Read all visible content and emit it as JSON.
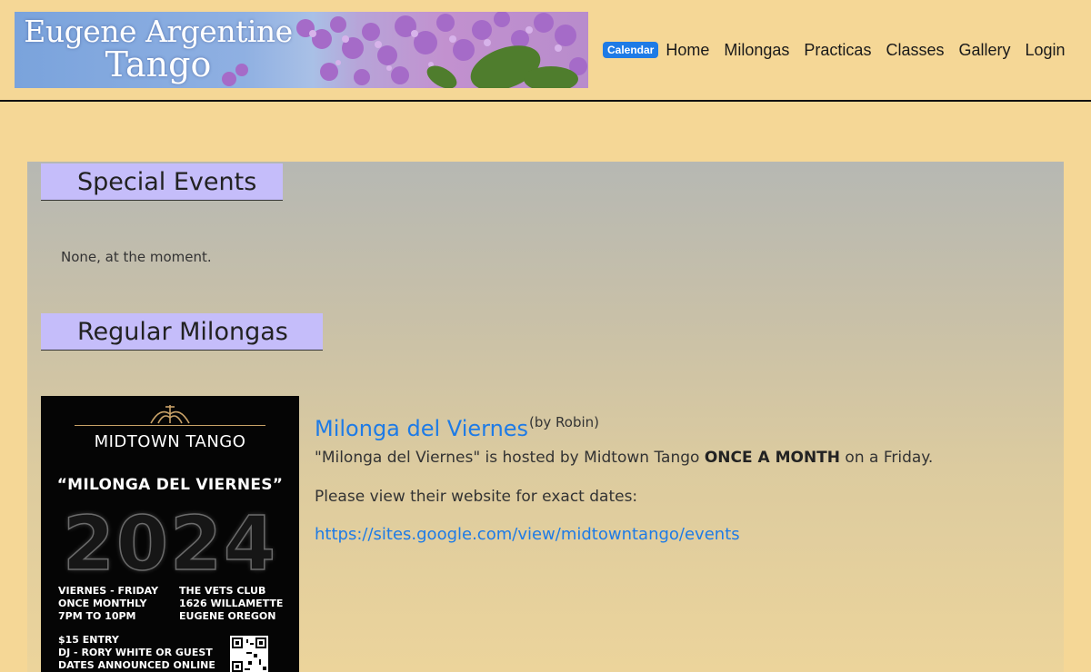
{
  "header": {
    "banner": {
      "line1": "Eugene Argentine",
      "line2": "Tango"
    },
    "badge": "Calendar",
    "nav": [
      "Home",
      "Milongas",
      "Practicas",
      "Classes",
      "Gallery",
      "Login"
    ]
  },
  "special_events": {
    "heading": "Special Events",
    "text": "None, at the moment."
  },
  "regular_milongas": {
    "heading": "Regular Milongas",
    "poster": {
      "brand": "MIDTOWN TANGO",
      "subtitle": "“MILONGA DEL VIERNES”",
      "year": "2024",
      "left_info": "VIERNES - FRIDAY\nONCE MONTHLY\n7PM TO 10PM",
      "right_info": "THE VETS CLUB\n1626 WILLAMETTE\nEUGENE OREGON",
      "left_info2": "$15 ENTRY\nDJ - RORY WHITE OR GUEST\nDATES ANNOUNCED ONLINE"
    },
    "event": {
      "title": "Milonga del Viernes",
      "by": "(by Robin)",
      "desc_pre": "\"Milonga del Viernes\" is hosted by Midtown Tango ",
      "desc_bold": "ONCE A MONTH",
      "desc_post": " on a Friday.",
      "note": "Please view their website for exact dates:",
      "link": "https://sites.google.com/view/midtowntango/events"
    }
  }
}
